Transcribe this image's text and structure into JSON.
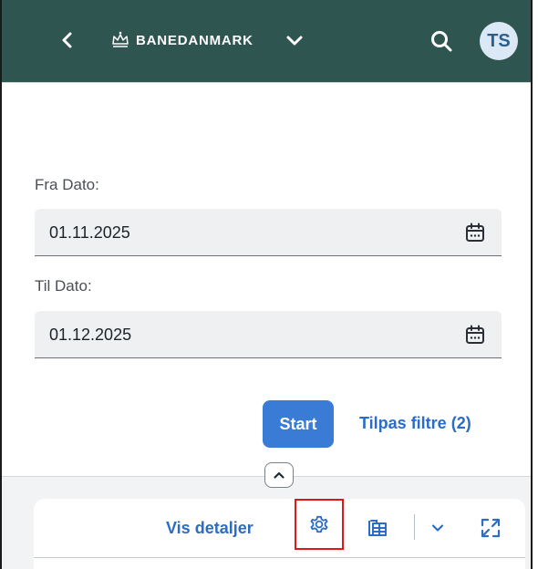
{
  "header": {
    "brand": "BANEDANMARK",
    "avatar_initials": "TS",
    "icons": [
      "chevron-left-icon",
      "crown-logo-icon",
      "chevron-down-icon",
      "search-icon"
    ]
  },
  "form": {
    "from_label": "Fra Dato:",
    "from_value": "01.11.2025",
    "to_label": "Til Dato:",
    "to_value": "01.12.2025"
  },
  "actions": {
    "start_label": "Start",
    "filters_label": "Tilpas filtre (2)"
  },
  "toolbar": {
    "details_label": "Vis detaljer",
    "icons": [
      "settings-icon",
      "table-export-icon",
      "chevron-down-icon",
      "fullscreen-icon"
    ]
  },
  "colors": {
    "header_bg": "#2f5550",
    "accent": "#3a7bd5",
    "link": "#2b6cc4",
    "highlight": "#e01717"
  }
}
